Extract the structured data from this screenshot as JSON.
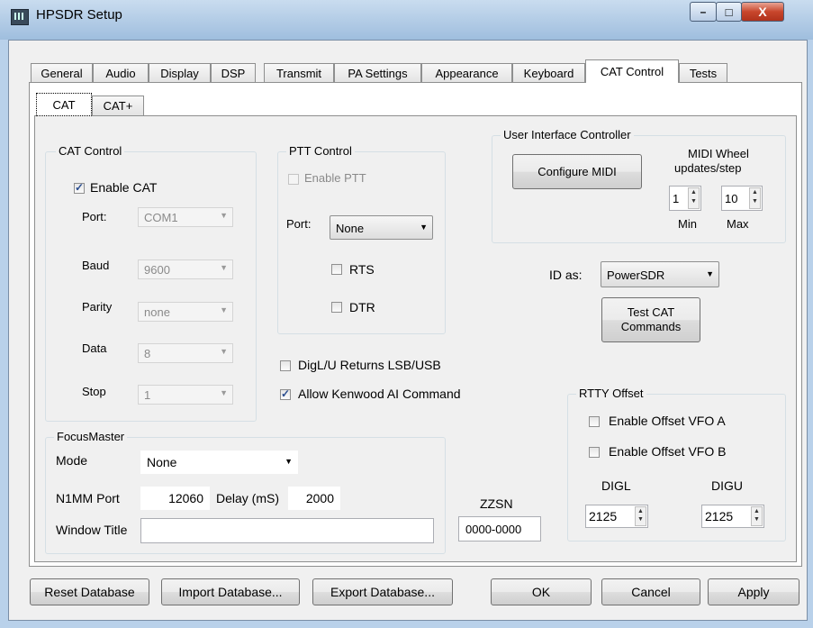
{
  "window": {
    "title": "HPSDR Setup",
    "minimize_glyph": "–",
    "maximize_glyph": "□",
    "close_glyph": "X"
  },
  "tabs": [
    "General",
    "Audio",
    "Display",
    "DSP",
    "Transmit",
    "PA Settings",
    "Appearance",
    "Keyboard",
    "CAT Control",
    "Tests"
  ],
  "active_tab": "CAT Control",
  "subtabs": [
    "CAT",
    "CAT+"
  ],
  "active_subtab": "CAT",
  "cat_control": {
    "title": "CAT Control",
    "enable_cat": {
      "label": "Enable CAT",
      "checked": true
    },
    "port": {
      "label": "Port:",
      "value": "COM1"
    },
    "baud": {
      "label": "Baud",
      "value": "9600"
    },
    "parity": {
      "label": "Parity",
      "value": "none"
    },
    "data": {
      "label": "Data",
      "value": "8"
    },
    "stop": {
      "label": "Stop",
      "value": "1"
    }
  },
  "ptt_control": {
    "title": "PTT Control",
    "enable_ptt": {
      "label": "Enable PTT",
      "checked": false
    },
    "port": {
      "label": "Port:",
      "value": "None"
    },
    "rts": {
      "label": "RTS",
      "checked": false
    },
    "dtr": {
      "label": "DTR",
      "checked": false
    }
  },
  "ui_controller": {
    "title": "User Interface Controller",
    "configure_midi": "Configure MIDI",
    "midi_wheel": "MIDI  Wheel",
    "updates_step": "updates/step",
    "min": {
      "label": "Min",
      "value": "1"
    },
    "max": {
      "label": "Max",
      "value": "10"
    }
  },
  "id_as": {
    "label": "ID as:",
    "value": "PowerSDR"
  },
  "test_cat": {
    "line1": "Test CAT",
    "line2": "Commands"
  },
  "digl_returns": {
    "label": "DigL/U Returns LSB/USB",
    "checked": false
  },
  "allow_kenwood": {
    "label": "Allow Kenwood AI Command",
    "checked": true
  },
  "rtty_offset": {
    "title": "RTTY Offset",
    "vfo_a": {
      "label": "Enable Offset VFO A",
      "checked": false
    },
    "vfo_b": {
      "label": "Enable Offset VFO B",
      "checked": false
    },
    "digl": {
      "label": "DIGL",
      "value": "2125"
    },
    "digu": {
      "label": "DIGU",
      "value": "2125"
    }
  },
  "focus_master": {
    "title": "FocusMaster",
    "mode": {
      "label": "Mode",
      "value": "None"
    },
    "n1mm_port": {
      "label": "N1MM Port",
      "value": "12060"
    },
    "delay": {
      "label": "Delay (mS)",
      "value": "2000"
    },
    "window_title": {
      "label": "Window Title",
      "value": ""
    }
  },
  "zzsn": {
    "label": "ZZSN",
    "value": "0000-0000"
  },
  "buttons": {
    "reset": "Reset Database",
    "import": "Import Database...",
    "export": "Export Database...",
    "ok": "OK",
    "cancel": "Cancel",
    "apply": "Apply"
  },
  "colors": {
    "titlebar": "#b9d1ea",
    "close_button": "#c8462c",
    "panel": "#f0f0f0"
  }
}
